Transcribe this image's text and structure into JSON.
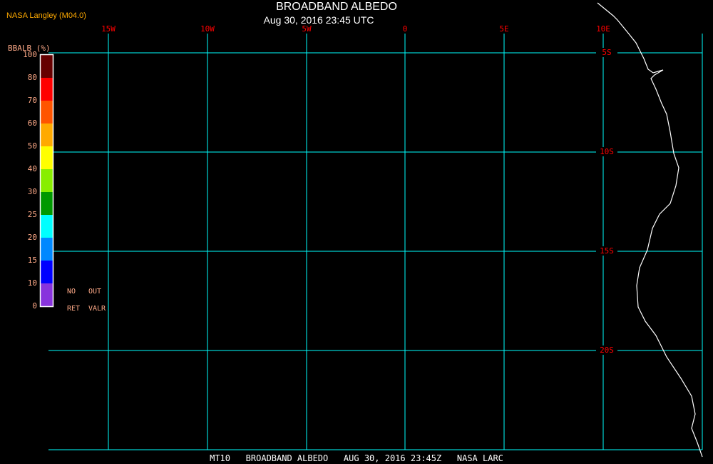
{
  "header": {
    "title": "BROADBAND ALBEDO",
    "subtitle": "Aug 30, 2016 23:45 UTC",
    "credit": "NASA Langley (M04.0)"
  },
  "legend": {
    "title": "BBALB (%)",
    "labels": [
      "100",
      "80",
      "70",
      "60",
      "50",
      "40",
      "30",
      "25",
      "20",
      "15",
      "10",
      "0"
    ],
    "colors": [
      "#660000",
      "#ff0000",
      "#ff5500",
      "#ffaa00",
      "#ffff00",
      "#88ee00",
      "#009900",
      "#00ffff",
      "#0088ff",
      "#0000ff",
      "#8833dd"
    ],
    "no_ret": [
      "NO",
      "RET"
    ],
    "out_valr": [
      "OUT",
      "VALR"
    ]
  },
  "map": {
    "lon_labels": [
      "15W",
      "10W",
      "5W",
      "0",
      "5E",
      "10E"
    ],
    "lat_labels": [
      "5S",
      "10S",
      "15S",
      "20S"
    ],
    "grid_color": "#00ffff",
    "label_color": "#ff0000",
    "coast_color": "#ffffff"
  },
  "footer": {
    "caption": "MT10   BROADBAND ALBEDO   AUG 30, 2016 23:45Z   NASA LARC"
  }
}
